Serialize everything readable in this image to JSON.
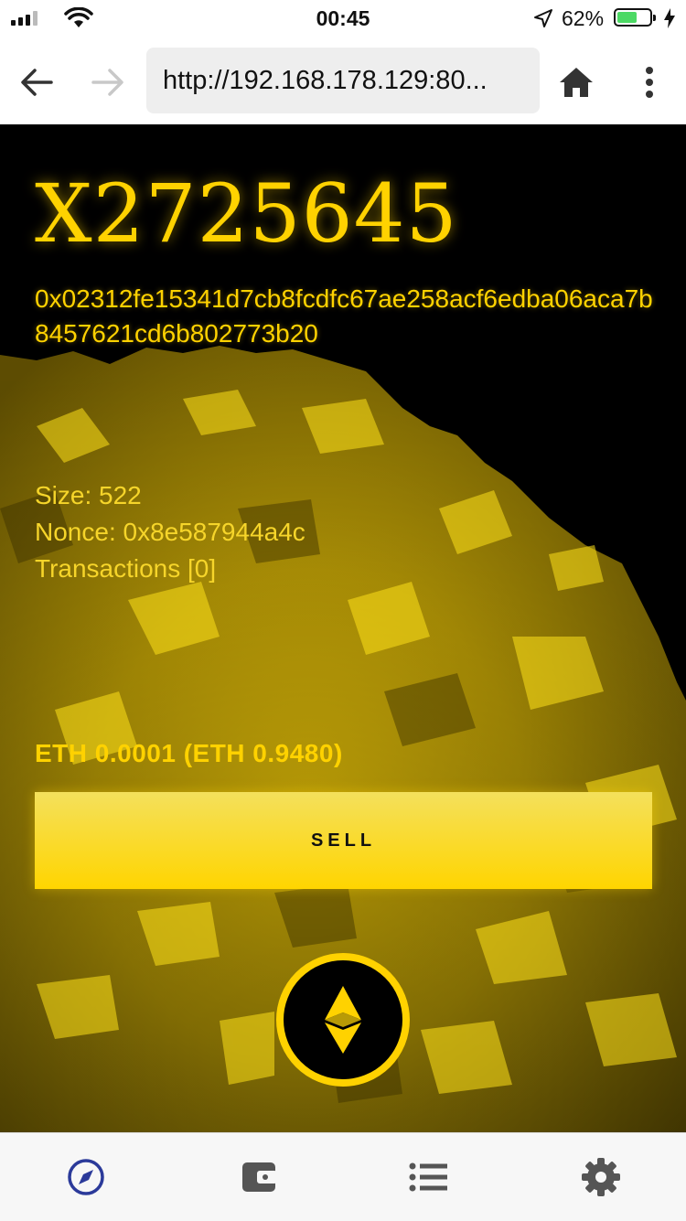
{
  "status_bar": {
    "time": "00:45",
    "battery": "62%",
    "battery_level": 0.62
  },
  "browser": {
    "url": "http://192.168.178.129:80..."
  },
  "block": {
    "title": "X2725645",
    "hash": "0x02312fe15341d7cb8fcdfc67ae258acf6edba06aca7b8457621cd6b802773b20",
    "size": "Size: 522",
    "nonce": "Nonce: 0x8e587944a4c",
    "transactions": "Transactions [0]",
    "price": "ETH 0.0001 (ETH 0.9480)"
  },
  "actions": {
    "sell_label": "SELL"
  },
  "colors": {
    "accent": "#ffd200",
    "dark": "#000000",
    "nav_active": "#2b3a9a",
    "nav_inactive": "#555555"
  },
  "bottom_nav": {
    "items": [
      {
        "icon": "compass-icon",
        "active": true
      },
      {
        "icon": "wallet-icon",
        "active": false
      },
      {
        "icon": "list-icon",
        "active": false
      },
      {
        "icon": "gear-icon",
        "active": false
      }
    ]
  }
}
